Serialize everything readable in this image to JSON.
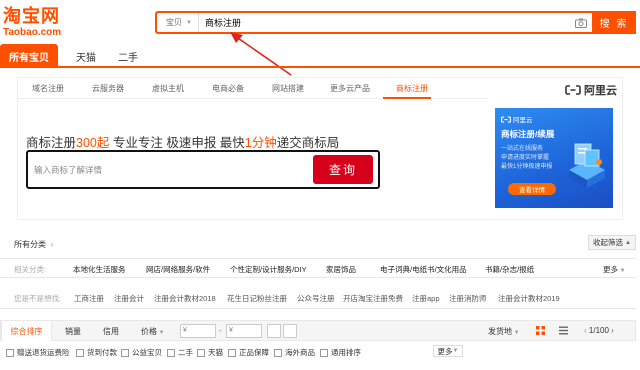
{
  "logo": {
    "cn": "淘宝网",
    "en": "Taobao.com"
  },
  "search": {
    "scope": "宝贝",
    "query": "商标注册",
    "button": "搜 索"
  },
  "tabs": [
    "所有宝贝",
    "天猫",
    "二手"
  ],
  "ad": {
    "nav": [
      "域名注册",
      "云服务器",
      "虚拟主机",
      "电商必备",
      "网站搭建",
      "更多云产品",
      "商标注册"
    ],
    "brand": "阿里云",
    "slogan": {
      "p1": "商标注册",
      "p2": "300起",
      "p3": " 专业专注 极速申报 最快",
      "p4": "1分钟",
      "p5": "递交商标局"
    },
    "placeholder": "输入商标了解详情",
    "query_button": "查询",
    "banner": {
      "logo": "阿里云",
      "title": "商标注册/续展",
      "lines": [
        "一站式在线服务",
        "申请进度实时掌握",
        "最快1分钟极速申报"
      ],
      "button": "查看详情"
    }
  },
  "filters": {
    "all_categories": "所有分类",
    "collapse": "收起筛选",
    "related_label": "相关分类:",
    "related": [
      "本地化生活服务",
      "网店/网络服务/软件",
      "个性定制/设计服务/DIY",
      "家居饰品",
      "电子词典/电纸书/文化用品",
      "书籍/杂志/报纸"
    ],
    "more": "更多",
    "guess_label": "您是不是想找:",
    "guess": [
      "工商注册",
      "注册会计",
      "注册会计教材2018",
      "花生日记粉丝注册",
      "公众号注册",
      "开店淘宝注册免费",
      "注册app",
      "注册消防师",
      "注册会计教材2019"
    ]
  },
  "sort": {
    "items": [
      "综合排序",
      "销量",
      "信用",
      "价格"
    ],
    "price_from": "¥",
    "price_to": "¥",
    "dash": "-",
    "ship_from": "发货地",
    "page": "1/100"
  },
  "checks": {
    "items": [
      "赠送退货运费险",
      "货到付款",
      "公益宝贝",
      "二手",
      "天猫",
      "正品保障",
      "海外商品",
      "通用排序"
    ],
    "more": "更多"
  },
  "colors": {
    "accent": "#ff5000",
    "query_button": "#d6001a",
    "banner": "#1d63d8"
  }
}
